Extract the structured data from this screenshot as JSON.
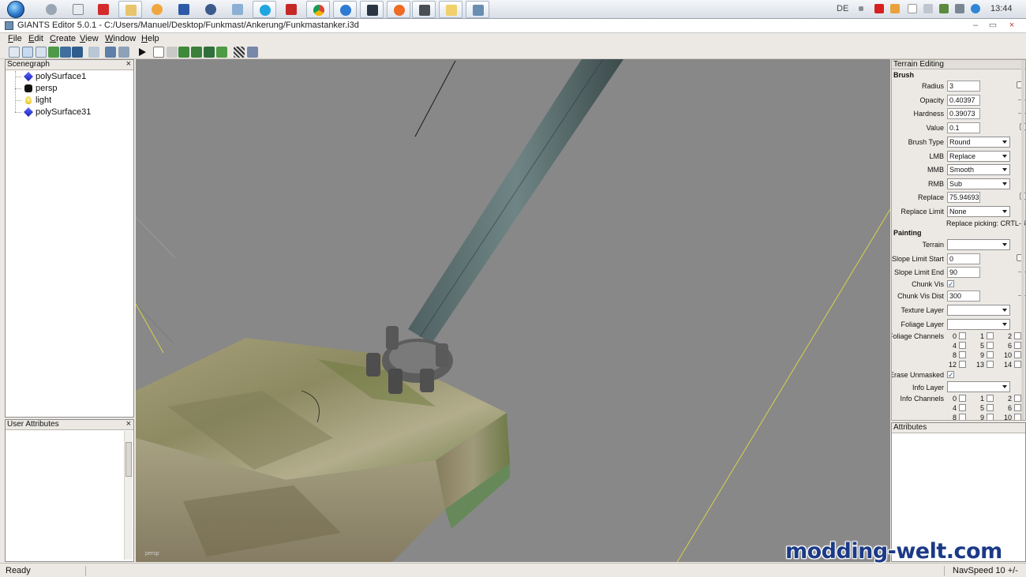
{
  "taskbar": {
    "language": "DE",
    "clock": "13:44"
  },
  "window": {
    "title": "GIANTS Editor 5.0.1 - C:/Users/Manuel/Desktop/Funkmast/Ankerung/Funkmastanker.i3d"
  },
  "menu": [
    {
      "label": "File",
      "u": "F",
      "rest": "ile"
    },
    {
      "label": "Edit",
      "u": "E",
      "rest": "dit"
    },
    {
      "label": "Create",
      "u": "C",
      "rest": "reate"
    },
    {
      "label": "View",
      "u": "V",
      "rest": "iew"
    },
    {
      "label": "Window",
      "u": "W",
      "rest": "indow"
    },
    {
      "label": "Help",
      "u": "H",
      "rest": "elp"
    }
  ],
  "scenegraph": {
    "title": "Scenegraph",
    "items": [
      {
        "label": "polySurface1",
        "icon": "shape-icon"
      },
      {
        "label": "persp",
        "icon": "camera-icon"
      },
      {
        "label": "light",
        "icon": "light-icon"
      },
      {
        "label": "polySurface31",
        "icon": "shape-icon"
      }
    ]
  },
  "user_attributes": {
    "title": "User Attributes"
  },
  "viewport": {
    "camera_label": "persp"
  },
  "terrain_editing": {
    "title": "Terrain Editing",
    "brush_section": "Brush",
    "radius_label": "Radius",
    "radius_value": "3",
    "opacity_label": "Opacity",
    "opacity_value": "0.40397",
    "hardness_label": "Hardness",
    "hardness_value": "0.39073",
    "value_label": "Value",
    "value_value": "0.1",
    "brush_type_label": "Brush Type",
    "brush_type_value": "Round",
    "lmb_label": "LMB",
    "lmb_value": "Replace",
    "mmb_label": "MMB",
    "mmb_value": "Smooth",
    "rmb_label": "RMB",
    "rmb_value": "Sub",
    "replace_label": "Replace",
    "replace_value": "75.94693",
    "replace_limit_label": "Replace Limit",
    "replace_limit_value": "None",
    "replace_picking": "Replace picking: CRTL-R",
    "painting_section": "Painting",
    "terrain_label": "Terrain",
    "terrain_value": "",
    "slope_start_label": "Slope Limit Start",
    "slope_start_value": "0",
    "slope_end_label": "Slope Limit End",
    "slope_end_value": "90",
    "chunk_vis_label": "Chunk Vis",
    "chunk_vis_dist_label": "Chunk Vis Dist",
    "chunk_vis_dist_value": "300",
    "texture_layer_label": "Texture Layer",
    "texture_layer_value": "",
    "foliage_layer_label": "Foliage Layer",
    "foliage_layer_value": "",
    "foliage_channels_label": "Foliage Channels",
    "foliage_channels": [
      "0",
      "1",
      "2",
      "4",
      "5",
      "6",
      "8",
      "9",
      "10",
      "12",
      "13",
      "14"
    ],
    "erase_unmasked_label": "Erase Unmasked",
    "info_layer_label": "Info Layer",
    "info_layer_value": "",
    "info_channels_label": "Info Channels",
    "info_channels": [
      "0",
      "1",
      "2",
      "4",
      "5",
      "6",
      "8",
      "9",
      "10"
    ],
    "check_mark": "✓"
  },
  "attributes": {
    "title": "Attributes"
  },
  "status": {
    "text": "Ready",
    "nav_speed": "NavSpeed 10 +/-"
  },
  "watermark": "modding-welt.com",
  "close_glyph": "×"
}
